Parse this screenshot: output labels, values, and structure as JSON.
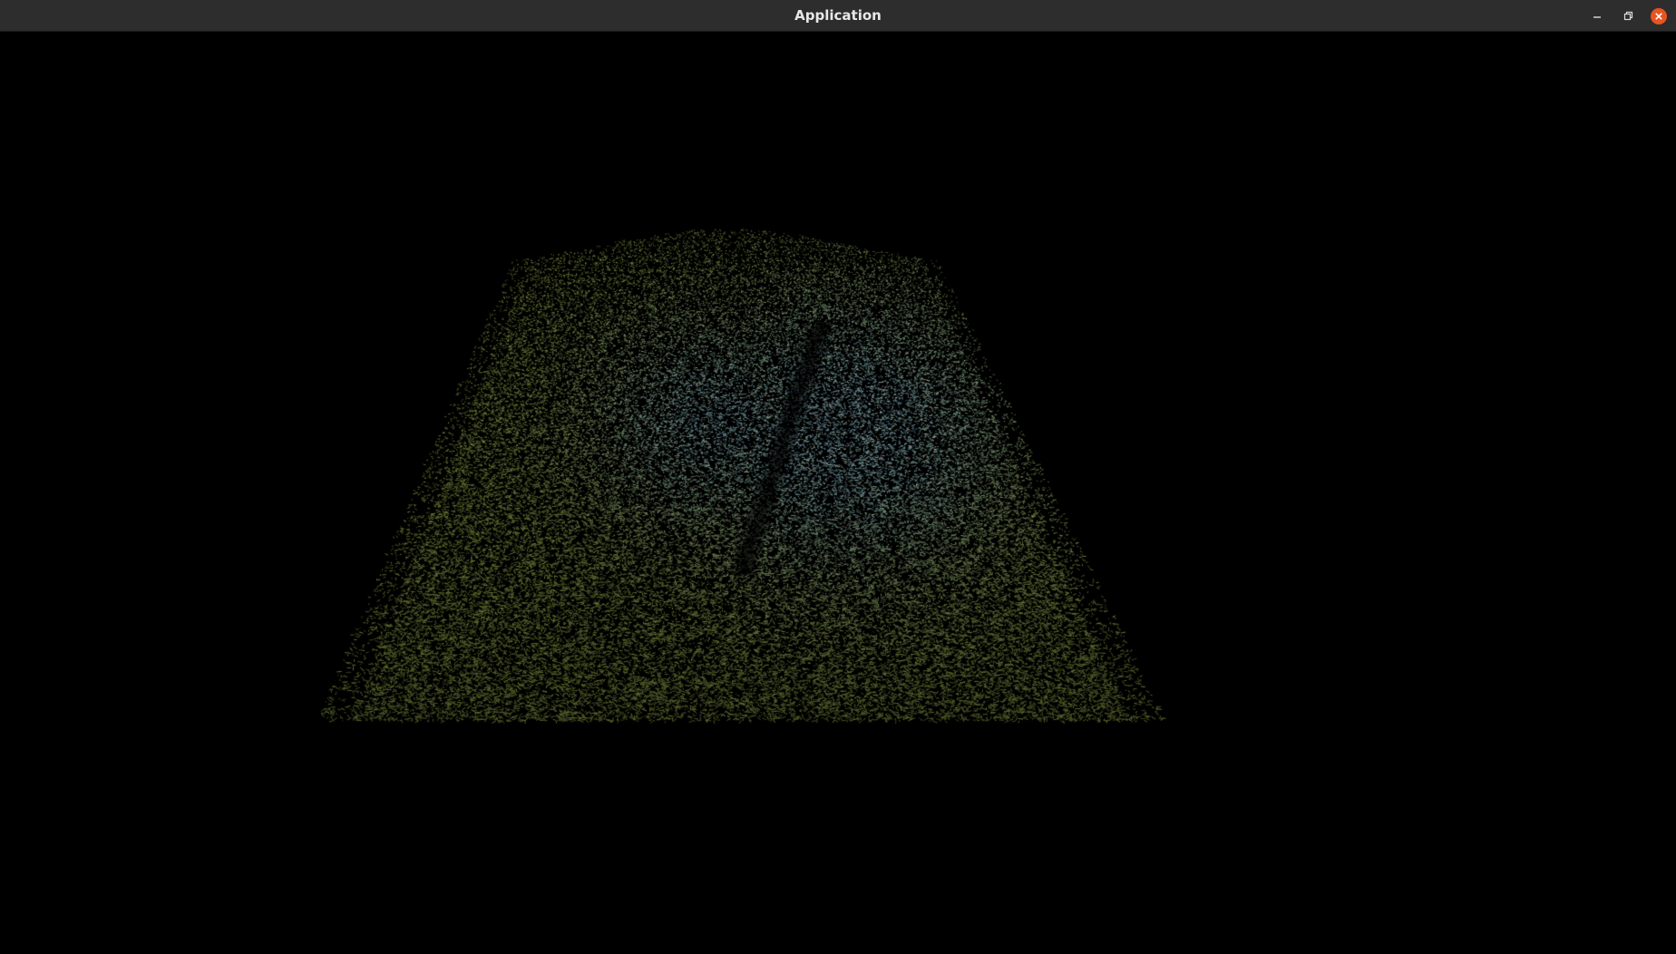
{
  "window": {
    "title": "Application",
    "buttons": {
      "minimize": "minimize-icon",
      "maximize": "restore-icon",
      "close": "close-icon"
    },
    "colors": {
      "titlebar": "#2d2d2d",
      "title_text": "#e8e8e8",
      "close_button": "#e95420",
      "background": "#000000"
    }
  },
  "viewport": {
    "content": "point-cloud-terrain",
    "colors": {
      "low": "#9aa84a",
      "mid": "#7f9a3c",
      "high": "#7fb6c9",
      "peak": "#a8d4e0"
    }
  }
}
